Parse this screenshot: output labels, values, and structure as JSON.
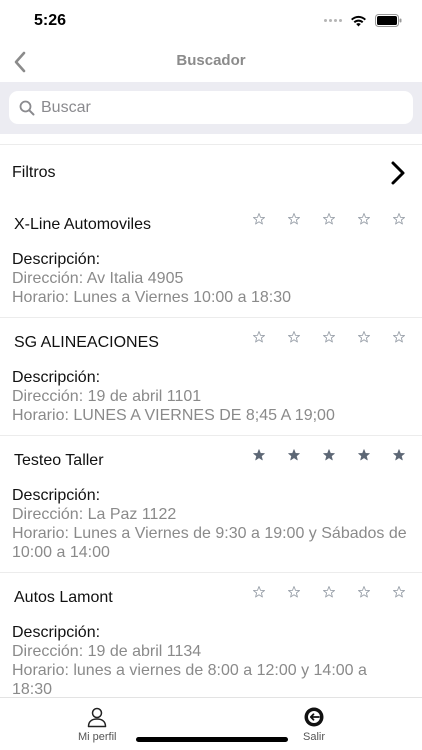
{
  "status_bar": {
    "time": "5:26"
  },
  "nav": {
    "title": "Buscador"
  },
  "search": {
    "placeholder": "Buscar"
  },
  "filters": {
    "label": "Filtros"
  },
  "results": [
    {
      "name": "X-Line Automoviles",
      "rating": 0,
      "description_label": "Descripción:",
      "address": "Dirección: Av Italia 4905",
      "hours": "Horario: Lunes a Viernes 10:00 a 18:30"
    },
    {
      "name": "SG ALINEACIONES",
      "rating": 0,
      "description_label": "Descripción:",
      "address": "Dirección: 19 de abril 1101",
      "hours": "Horario: LUNES A VIERNES DE 8;45 A 19;00"
    },
    {
      "name": "Testeo Taller",
      "rating": 5,
      "description_label": "Descripción:",
      "address": "Dirección: La Paz 1122",
      "hours": "Horario: Lunes a Viernes de 9:30 a 19:00 y Sábados de 10:00 a 14:00"
    },
    {
      "name": "Autos Lamont",
      "rating": 0,
      "description_label": "Descripción:",
      "address": "Dirección: 19 de abril 1134",
      "hours": "Horario: lunes a viernes de 8:00 a 12:00 y 14:00 a 18:30"
    }
  ],
  "tab_bar": {
    "profile_label": "Mi perfil",
    "logout_label": "Salir"
  },
  "colors": {
    "star_filled": "#5d6775",
    "star_empty": "#9aa1aa",
    "secondary_text": "#8a8a8a",
    "search_background": "#ececf2"
  }
}
